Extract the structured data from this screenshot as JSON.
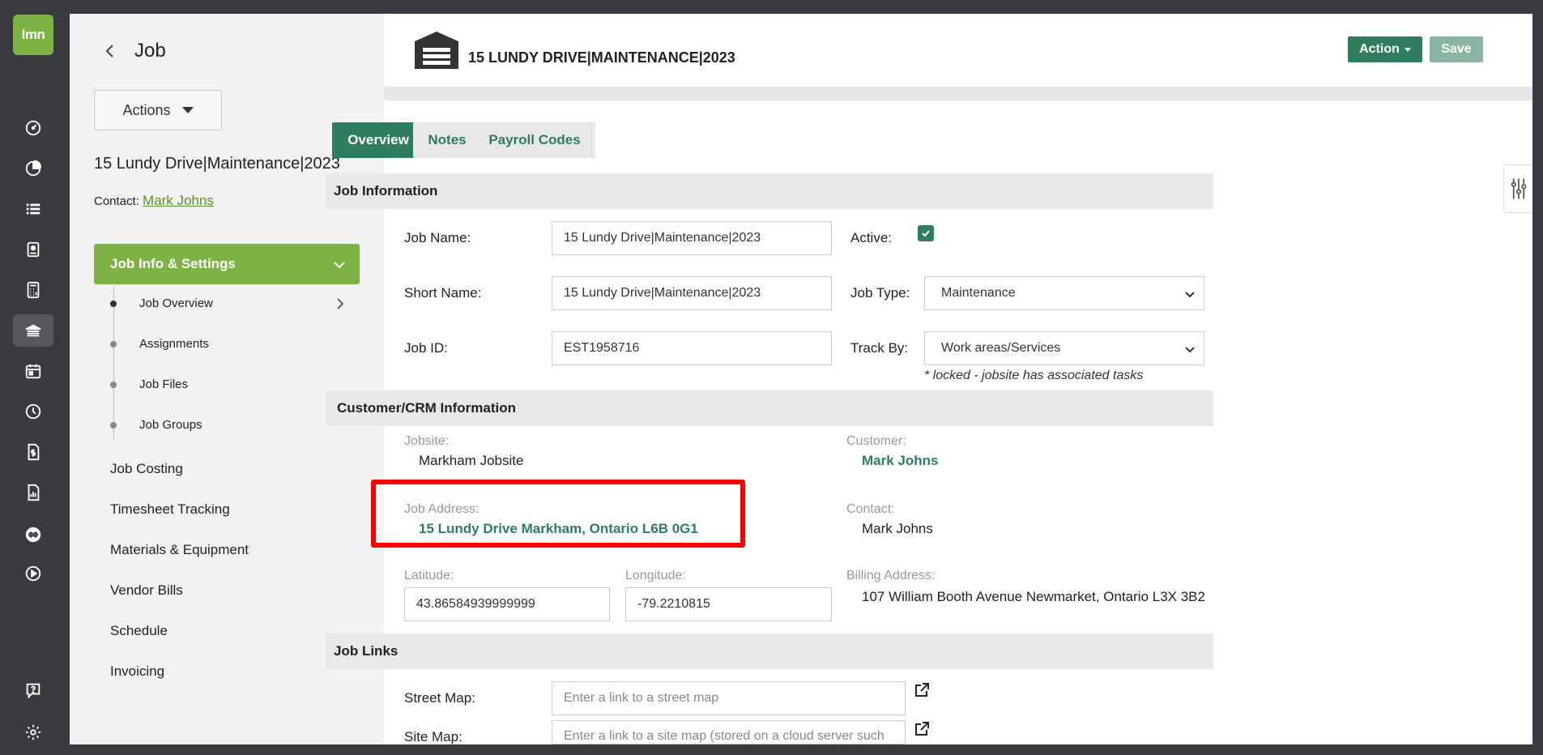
{
  "app": {
    "logo_text": "lmn"
  },
  "rail": {
    "icons": [
      "dashboard-icon",
      "chart-pie-icon",
      "list-icon",
      "clipboard-icon",
      "calculator-icon",
      "job-icon",
      "calendar-icon",
      "clock-icon",
      "invoice-icon",
      "report-icon",
      "quickbooks-icon",
      "play-icon",
      "help-icon",
      "gear-icon"
    ]
  },
  "sidebar": {
    "title": "Job",
    "actions_label": "Actions",
    "job_title": "15 Lundy Drive|Maintenance|2023",
    "contact_prefix": "Contact: ",
    "contact_name": "Mark Johns",
    "section_label": "Job Info & Settings",
    "subitems": [
      "Job Overview",
      "Assignments",
      "Job Files",
      "Job Groups"
    ],
    "nav": [
      "Job Costing",
      "Timesheet Tracking",
      "Materials & Equipment",
      "Vendor Bills",
      "Schedule",
      "Invoicing"
    ]
  },
  "header": {
    "title": "15 LUNDY DRIVE|MAINTENANCE|2023",
    "action_label": "Action",
    "save_label": "Save"
  },
  "tabs": [
    "Overview",
    "Notes",
    "Payroll Codes"
  ],
  "job_info": {
    "section_title": "Job Information",
    "job_name_label": "Job Name:",
    "job_name_value": "15 Lundy Drive|Maintenance|2023",
    "active_label": "Active:",
    "short_name_label": "Short Name:",
    "short_name_value": "15 Lundy Drive|Maintenance|2023",
    "job_type_label": "Job Type:",
    "job_type_value": "Maintenance",
    "job_id_label": "Job ID:",
    "job_id_value": "EST1958716",
    "track_by_label": "Track By:",
    "track_by_value": "Work areas/Services",
    "locked_note": "* locked - jobsite has associated tasks"
  },
  "crm": {
    "section_title": "Customer/CRM Information",
    "jobsite_label": "Jobsite:",
    "jobsite_value": "Markham Jobsite",
    "customer_label": "Customer:",
    "customer_value": "Mark Johns",
    "job_address_label": "Job Address:",
    "job_address_value": "15 Lundy Drive Markham, Ontario L6B 0G1",
    "contact_label": "Contact:",
    "contact_value": "Mark Johns",
    "latitude_label": "Latitude:",
    "latitude_value": "43.86584939999999",
    "longitude_label": "Longitude:",
    "longitude_value": "-79.2210815",
    "billing_label": "Billing Address:",
    "billing_value": "107 William Booth Avenue Newmarket, Ontario L3X 3B2"
  },
  "links": {
    "section_title": "Job Links",
    "street_map_label": "Street Map:",
    "street_map_placeholder": "Enter a link to a street map",
    "site_map_label": "Site Map:",
    "site_map_placeholder": "Enter a link to a site map (stored on a cloud server such"
  },
  "colors": {
    "brand_green": "#7cb342",
    "primary_teal": "#2e7d5f",
    "highlight_red": "#ff0000"
  }
}
